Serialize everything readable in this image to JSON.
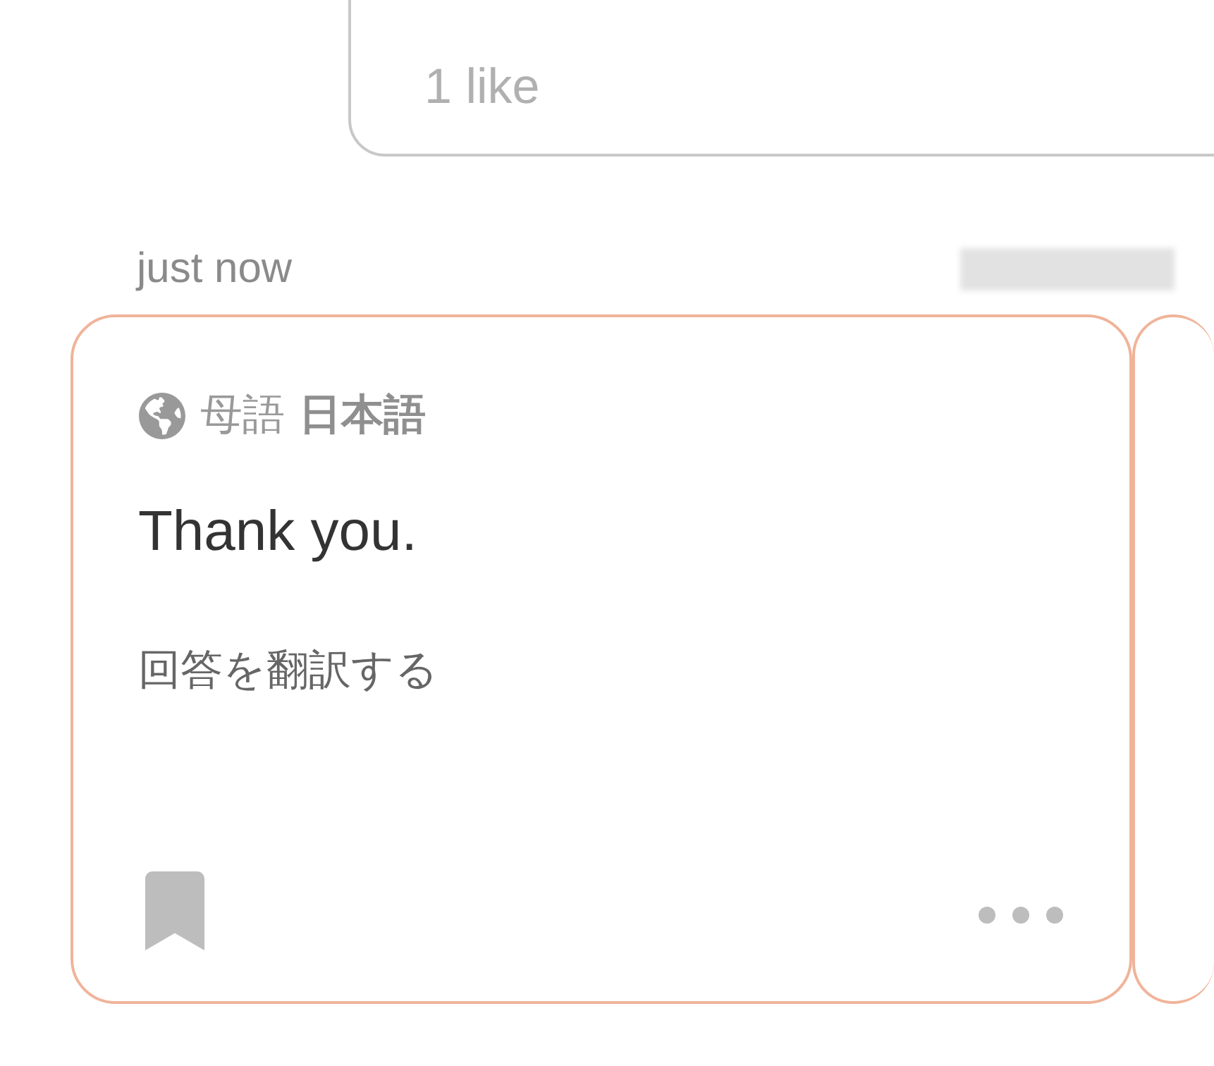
{
  "previous_answer": {
    "likes": "1 like"
  },
  "answer": {
    "time": "just now",
    "native_label": "母語",
    "native_language": "日本語",
    "text": "Thank you.",
    "translate_link": "回答を翻訳する",
    "bookmarked": false
  }
}
